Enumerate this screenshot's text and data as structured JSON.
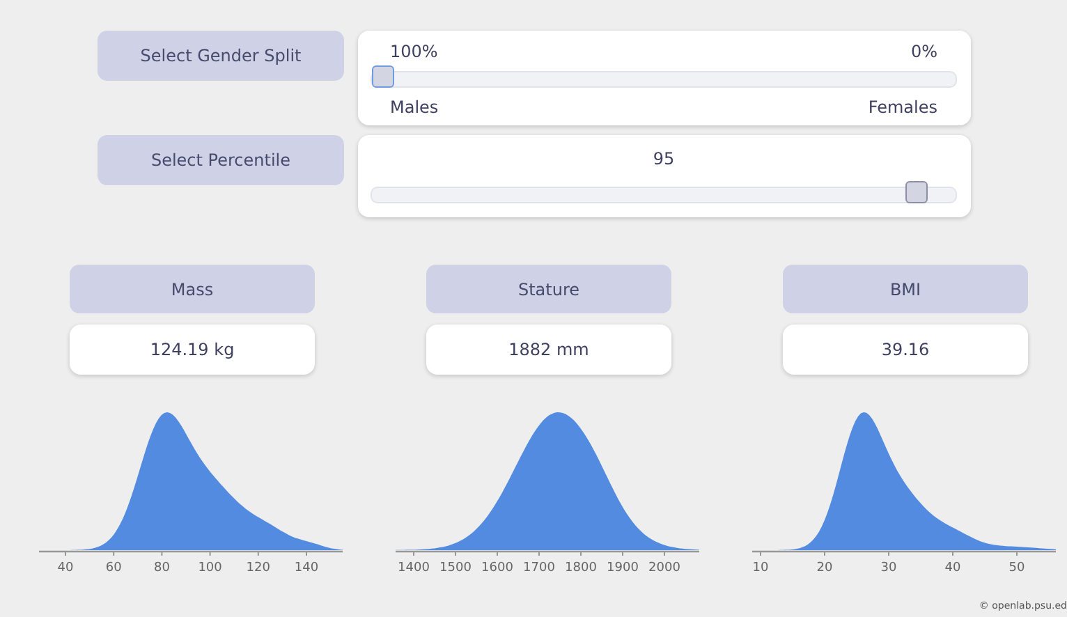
{
  "controls": [
    {
      "kind": "split",
      "label": "Select Gender Split",
      "left_value": "100%",
      "right_value": "0%",
      "left_label": "Males",
      "right_label": "Females",
      "level": 0,
      "focused": true
    },
    {
      "kind": "single",
      "label": "Select Percentile",
      "value": "95",
      "level": 0.95,
      "focused": false
    }
  ],
  "measures": [
    {
      "label": "Mass",
      "value": "124.19 kg",
      "axis_labels": [
        "40",
        "60",
        "80",
        "100",
        "120",
        "140"
      ]
    },
    {
      "label": "Stature",
      "value": "1882 mm",
      "axis_labels": [
        "1400",
        "1500",
        "1600",
        "1700",
        "1800",
        "1900",
        "2000"
      ]
    },
    {
      "label": "BMI",
      "value": "39.16",
      "axis_labels": [
        "10",
        "20",
        "30",
        "40",
        "50"
      ]
    }
  ],
  "credit": "© openlab.psu.ed"
}
